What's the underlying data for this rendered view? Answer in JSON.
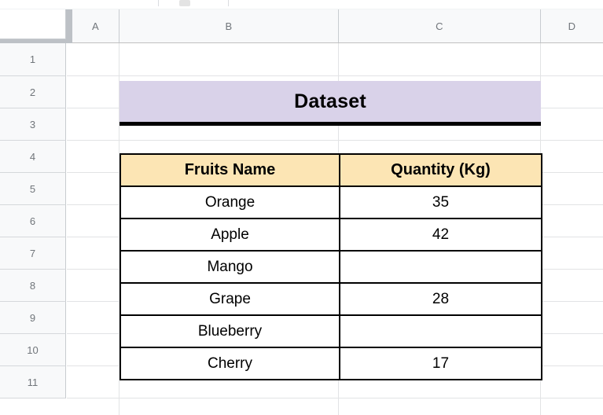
{
  "app": {
    "type": "spreadsheet",
    "toolbar_fragment": {
      "visible": true,
      "description": "partially cut off toolbar at top edge"
    }
  },
  "grid": {
    "column_headers": [
      "A",
      "B",
      "C",
      "D"
    ],
    "row_headers": [
      "1",
      "2",
      "3",
      "4",
      "5",
      "6",
      "7",
      "8",
      "9",
      "10",
      "11"
    ],
    "colors": {
      "header_bg": "#f8f9fa",
      "header_text": "#70757a",
      "gridline": "#e2e3e5",
      "corner_shade": "#bdc1c6"
    }
  },
  "title_banner": {
    "text": "Dataset",
    "background": "#d9d2e9",
    "underline_color": "#000000",
    "merged_range": "B2:C2"
  },
  "table": {
    "range": "B4:C10",
    "header_background": "#fce5b4",
    "border_color": "#000000",
    "columns": [
      {
        "key": "name",
        "label": "Fruits Name"
      },
      {
        "key": "qty",
        "label": "Quantity (Kg)"
      }
    ],
    "rows": [
      {
        "name": "Orange",
        "qty": "35"
      },
      {
        "name": "Apple",
        "qty": "42"
      },
      {
        "name": "Mango",
        "qty": ""
      },
      {
        "name": "Grape",
        "qty": "28"
      },
      {
        "name": "Blueberry",
        "qty": ""
      },
      {
        "name": "Cherry",
        "qty": "17"
      }
    ]
  }
}
